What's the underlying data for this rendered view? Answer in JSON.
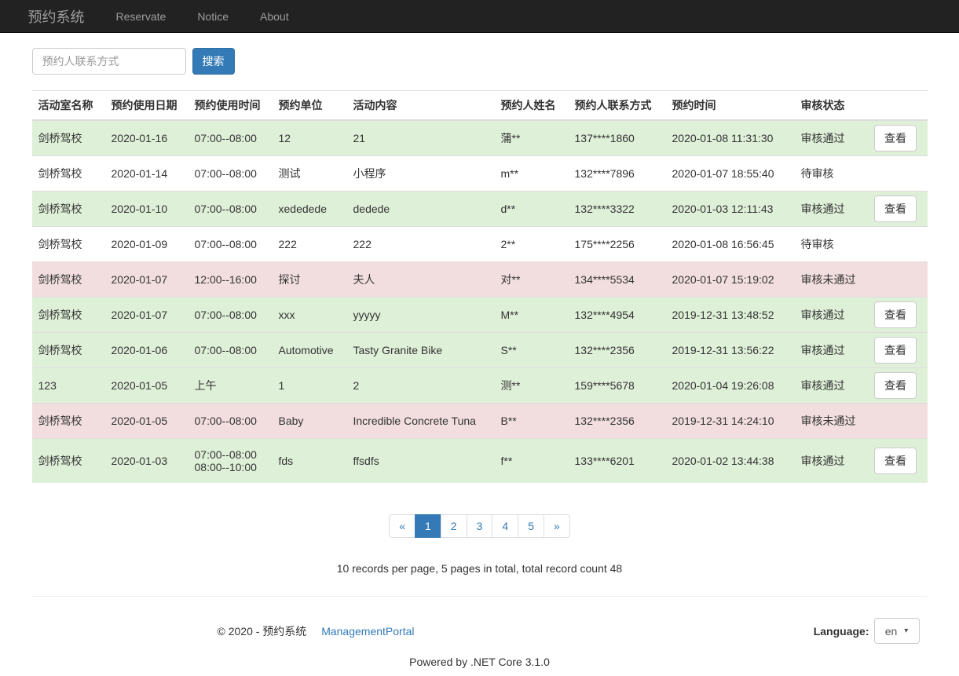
{
  "navbar": {
    "brand": "预约系统",
    "links": [
      {
        "label": "Reservate"
      },
      {
        "label": "Notice"
      },
      {
        "label": "About"
      }
    ]
  },
  "search": {
    "placeholder": "预约人联系方式",
    "button_label": "搜索"
  },
  "table": {
    "headers": [
      "活动室名称",
      "预约使用日期",
      "预约使用时间",
      "预约单位",
      "活动内容",
      "预约人姓名",
      "预约人联系方式",
      "预约时间",
      "审核状态",
      ""
    ],
    "rows": [
      {
        "room": "剑桥驾校",
        "date": "2020-01-16",
        "time": "07:00--08:00",
        "unit": "12",
        "content": "21",
        "name": "蒲**",
        "phone": "137****1860",
        "created": "2020-01-08 11:31:30",
        "status": "审核通过",
        "status_type": "approved",
        "view_label": "查看"
      },
      {
        "room": "剑桥驾校",
        "date": "2020-01-14",
        "time": "07:00--08:00",
        "unit": "测试",
        "content": "小程序",
        "name": "m**",
        "phone": "132****7896",
        "created": "2020-01-07 18:55:40",
        "status": "待审核",
        "status_type": "pending"
      },
      {
        "room": "剑桥驾校",
        "date": "2020-01-10",
        "time": "07:00--08:00",
        "unit": "xedededе",
        "content": "dedede",
        "name": "d**",
        "phone": "132****3322",
        "created": "2020-01-03 12:11:43",
        "status": "审核通过",
        "status_type": "approved",
        "view_label": "查看"
      },
      {
        "room": "剑桥驾校",
        "date": "2020-01-09",
        "time": "07:00--08:00",
        "unit": "222",
        "content": "222",
        "name": "2**",
        "phone": "175****2256",
        "created": "2020-01-08 16:56:45",
        "status": "待审核",
        "status_type": "pending"
      },
      {
        "room": "剑桥驾校",
        "date": "2020-01-07",
        "time": "12:00--16:00",
        "unit": "探讨",
        "content": "夫人",
        "name": "对**",
        "phone": "134****5534",
        "created": "2020-01-07 15:19:02",
        "status": "审核未通过",
        "status_type": "rejected"
      },
      {
        "room": "剑桥驾校",
        "date": "2020-01-07",
        "time": "07:00--08:00",
        "unit": "xxx",
        "content": "yyyyy",
        "name": "M**",
        "phone": "132****4954",
        "created": "2019-12-31 13:48:52",
        "status": "审核通过",
        "status_type": "approved",
        "view_label": "查看"
      },
      {
        "room": "剑桥驾校",
        "date": "2020-01-06",
        "time": "07:00--08:00",
        "unit": "Automotive",
        "content": "Tasty Granite Bike",
        "name": "S**",
        "phone": "132****2356",
        "created": "2019-12-31 13:56:22",
        "status": "审核通过",
        "status_type": "approved",
        "view_label": "查看"
      },
      {
        "room": "123",
        "date": "2020-01-05",
        "time": "上午",
        "unit": "1",
        "content": "2",
        "name": "测**",
        "phone": "159****5678",
        "created": "2020-01-04 19:26:08",
        "status": "审核通过",
        "status_type": "approved",
        "view_label": "查看"
      },
      {
        "room": "剑桥驾校",
        "date": "2020-01-05",
        "time": "07:00--08:00",
        "unit": "Baby",
        "content": "Incredible Concrete Tuna",
        "name": "B**",
        "phone": "132****2356",
        "created": "2019-12-31 14:24:10",
        "status": "审核未通过",
        "status_type": "rejected"
      },
      {
        "room": "剑桥驾校",
        "date": "2020-01-03",
        "time": "07:00--08:00\n08:00--10:00",
        "unit": "fds",
        "content": "ffsdfs",
        "name": "f**",
        "phone": "133****6201",
        "created": "2020-01-02 13:44:38",
        "status": "审核通过",
        "status_type": "approved",
        "view_label": "查看"
      }
    ]
  },
  "pagination": {
    "items": [
      {
        "label": "«",
        "active": false
      },
      {
        "label": "1",
        "active": true
      },
      {
        "label": "2",
        "active": false
      },
      {
        "label": "3",
        "active": false
      },
      {
        "label": "4",
        "active": false
      },
      {
        "label": "5",
        "active": false
      },
      {
        "label": "»",
        "active": false
      }
    ]
  },
  "summary": "10 records per page, 5 pages in total, total record count 48",
  "footer": {
    "copyright": "© 2020 - 预约系统",
    "portal_link": "ManagementPortal",
    "language_label": "Language:",
    "language_value": "en",
    "powered_by": "Powered by .NET Core 3.1.0"
  },
  "icons": {
    "caret_down": "▾"
  },
  "colors": {
    "navbar_bg": "#222222",
    "navbar_text": "#9d9d9d",
    "accent": "#337ab7",
    "approved_row": "#dff0d8",
    "rejected_row": "#f2dede",
    "pending_row": "#ffffff"
  }
}
